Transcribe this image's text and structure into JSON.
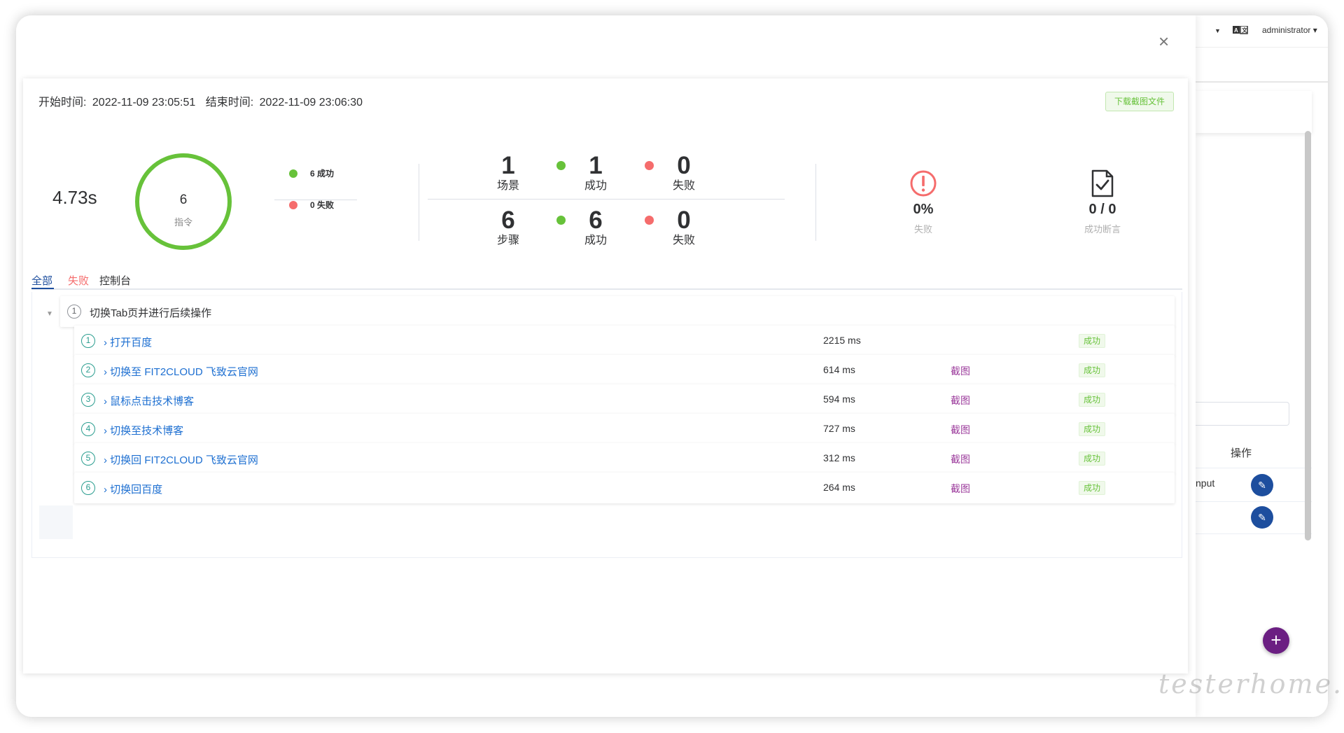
{
  "header": {
    "user": "administrator",
    "lang_icon": "language-icon"
  },
  "background": {
    "ops_header": "操作",
    "row_text": "nput"
  },
  "report": {
    "start_label": "开始时间:",
    "start_time": "2022-11-09 23:05:51",
    "end_label": "结束时间:",
    "end_time": "2022-11-09 23:06:30",
    "download_button": "下载截图文件",
    "duration": "4.73s",
    "ring": {
      "count": "6",
      "label": "指令",
      "success_fraction": 1.0
    },
    "legend": [
      {
        "text": "6 成功",
        "color": "#67c23a"
      },
      {
        "text": "0 失败",
        "color": "#f56c6c"
      }
    ],
    "scenario_stats": [
      {
        "num": "1",
        "label": "场景"
      },
      {
        "num": "1",
        "label": "成功"
      },
      {
        "num": "0",
        "label": "失败"
      }
    ],
    "step_stats": [
      {
        "num": "6",
        "label": "步骤"
      },
      {
        "num": "6",
        "label": "成功"
      },
      {
        "num": "0",
        "label": "失败"
      }
    ],
    "fail_rate": {
      "value": "0%",
      "caption": "失败"
    },
    "assertions": {
      "value": "0 / 0",
      "caption": "成功断言"
    }
  },
  "tabs": [
    {
      "label": "全部",
      "state": "active"
    },
    {
      "label": "失败",
      "state": "fail"
    },
    {
      "label": "控制台",
      "state": "normal"
    }
  ],
  "group": {
    "index": "1",
    "title": "切换Tab页并进行后续操作"
  },
  "steps": [
    {
      "index": "1",
      "name": "打开百度",
      "time": "2215 ms",
      "screenshot": "",
      "status": "成功"
    },
    {
      "index": "2",
      "name": "切换至 FIT2CLOUD 飞致云官网",
      "time": "614 ms",
      "screenshot": "截图",
      "status": "成功"
    },
    {
      "index": "3",
      "name": "鼠标点击技术博客",
      "time": "594 ms",
      "screenshot": "截图",
      "status": "成功"
    },
    {
      "index": "4",
      "name": "切换至技术博客",
      "time": "727 ms",
      "screenshot": "截图",
      "status": "成功"
    },
    {
      "index": "5",
      "name": "切换回 FIT2CLOUD 飞致云官网",
      "time": "312 ms",
      "screenshot": "截图",
      "status": "成功"
    },
    {
      "index": "6",
      "name": "切换回百度",
      "time": "264 ms",
      "screenshot": "截图",
      "status": "成功"
    }
  ],
  "colors": {
    "success": "#67c23a",
    "fail": "#f56c6c",
    "primary": "#1d4e9e",
    "link": "#1d6fd1",
    "screenshot": "#9c3c9c"
  },
  "watermark": "testerhome.com"
}
